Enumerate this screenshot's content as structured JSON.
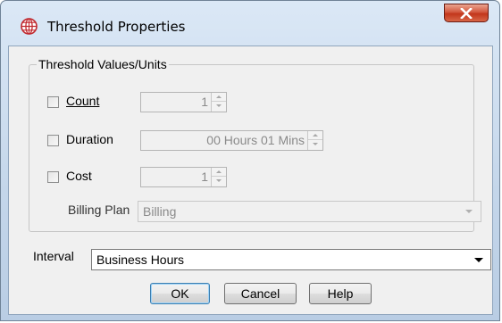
{
  "window": {
    "title": "Threshold Properties"
  },
  "group": {
    "title": "Threshold Values/Units"
  },
  "fields": {
    "count": {
      "label": "Count",
      "checked": false,
      "value": "1"
    },
    "duration": {
      "label": "Duration",
      "checked": false,
      "value": "00 Hours 01 Mins"
    },
    "cost": {
      "label": "Cost",
      "checked": false,
      "value": "1"
    },
    "billing_plan": {
      "label": "Billing Plan",
      "value": "Billing",
      "enabled": false
    }
  },
  "interval": {
    "label": "Interval",
    "value": "Business Hours"
  },
  "buttons": {
    "ok": "OK",
    "cancel": "Cancel",
    "help": "Help"
  },
  "colors": {
    "title_bar": "#c4d6ea",
    "close_button": "#c2361c",
    "dialog_background": "#f0f0f0",
    "default_button_border": "#3c7fb1"
  },
  "icons": {
    "app": "globe-icon",
    "close": "close-icon"
  }
}
